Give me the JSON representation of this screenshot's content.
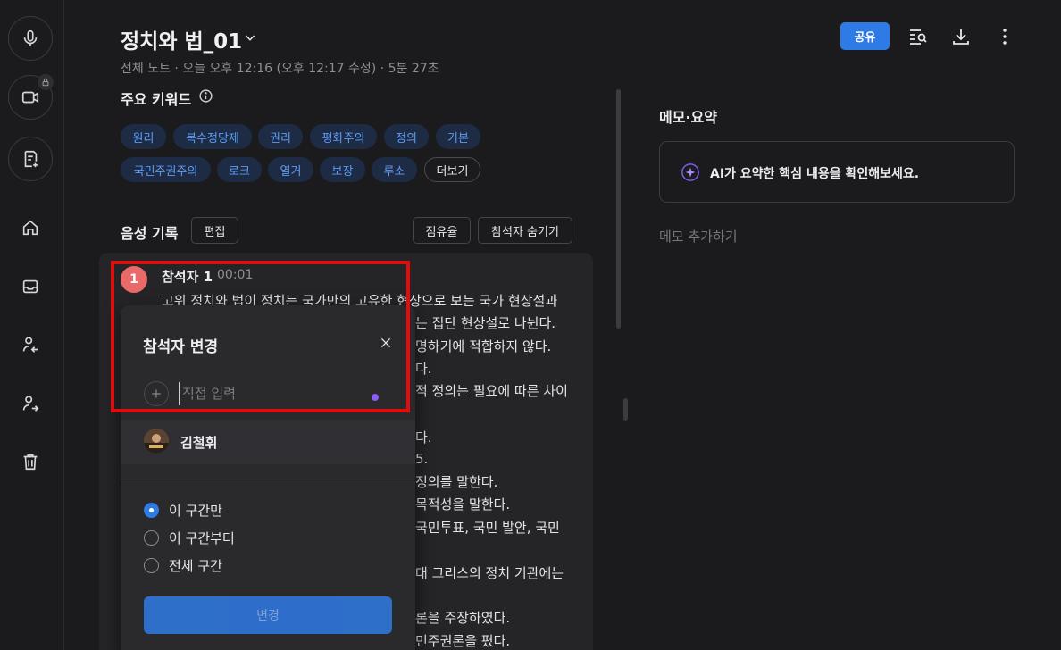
{
  "header": {
    "title": "정치와 법_01",
    "meta": "전체 노트 · 오늘 오후 12:16 (오후 12:17 수정) · 5분 27초",
    "share_label": "공유"
  },
  "keywords": {
    "title": "주요 키워드",
    "items": [
      "원리",
      "복수정당제",
      "권리",
      "평화주의",
      "정의",
      "기본",
      "국민주권주의",
      "로크",
      "열거",
      "보장",
      "루소"
    ],
    "more_label": "더보기"
  },
  "transcript": {
    "title": "음성 기록",
    "edit_label": "편집",
    "share_ratio_label": "점유율",
    "hide_speakers_label": "참석자 숨기기",
    "speaker_number": "1",
    "speaker": "참석자 1",
    "timestamp": "00:01",
    "line_first": "고위 정치와 법이 정치는 국가만의 고유한 현상으로 보는 국가 현상설과",
    "lines_right": [
      "는 집단 현상설로 나뉜다.",
      "명하기에 적합하지 않다.",
      "다.",
      "적 정의는 필요에 따른 차이",
      "",
      "다.",
      "5.",
      "정의를 말한다.",
      "목적성을 말한다.",
      "국민투표, 국민 발안, 국민",
      "",
      "대 그리스의 정치 기관에는",
      "",
      "론을 주장하였다.",
      "민주권론을 폈다."
    ]
  },
  "memo": {
    "title": "메모·요약",
    "ai_prompt": "AI가 요약한 핵심 내용을 확인해보세요.",
    "add_label": "메모 추가하기"
  },
  "popup": {
    "title": "참석자 변경",
    "input_placeholder": "직접 입력",
    "person_name": "김철휘",
    "options": [
      "이 구간만",
      "이 구간부터",
      "전체 구간"
    ],
    "selected_option": "이 구간만",
    "change_label": "변경"
  },
  "colors": {
    "accent": "#2f7be6",
    "chip_text": "#5c9bf5",
    "badge": "#ea6a6a",
    "highlight_box": "#e10c0c"
  }
}
